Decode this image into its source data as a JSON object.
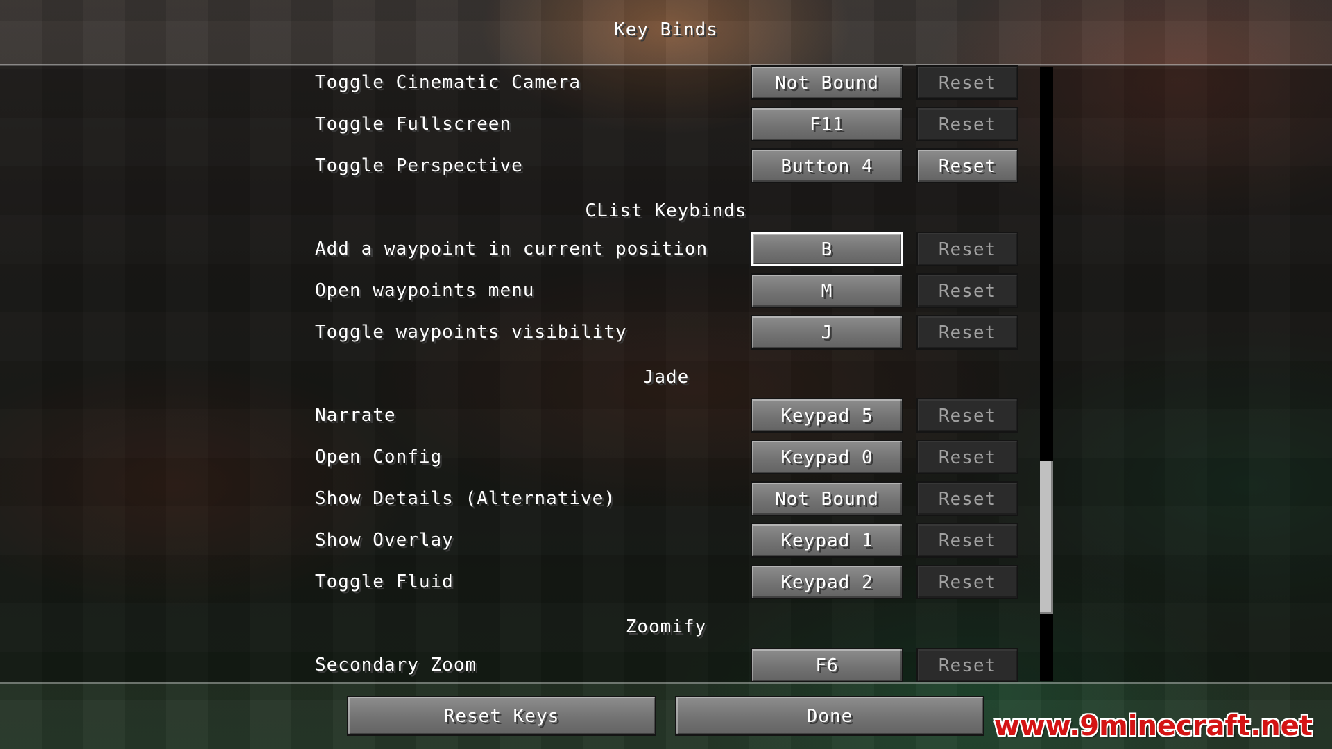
{
  "screen": {
    "title": "Key Binds"
  },
  "rows": {
    "toggle_cinematic_camera": {
      "label": "Toggle Cinematic Camera",
      "key": "Not Bound",
      "reset": "Reset"
    },
    "toggle_fullscreen": {
      "label": "Toggle Fullscreen",
      "key": "F11",
      "reset": "Reset"
    },
    "toggle_perspective": {
      "label": "Toggle Perspective",
      "key": "Button 4",
      "reset": "Reset"
    }
  },
  "categories": {
    "clist": {
      "title": "CList Keybinds",
      "add_waypoint": {
        "label": "Add a waypoint in current position",
        "key": "B",
        "reset": "Reset"
      },
      "open_waypoints_menu": {
        "label": "Open waypoints menu",
        "key": "M",
        "reset": "Reset"
      },
      "toggle_waypoints_visibility": {
        "label": "Toggle waypoints visibility",
        "key": "J",
        "reset": "Reset"
      }
    },
    "jade": {
      "title": "Jade",
      "narrate": {
        "label": "Narrate",
        "key": "Keypad 5",
        "reset": "Reset"
      },
      "open_config": {
        "label": "Open Config",
        "key": "Keypad 0",
        "reset": "Reset"
      },
      "show_details_alternative": {
        "label": "Show Details (Alternative)",
        "key": "Not Bound",
        "reset": "Reset"
      },
      "show_overlay": {
        "label": "Show Overlay",
        "key": "Keypad 1",
        "reset": "Reset"
      },
      "toggle_fluid": {
        "label": "Toggle Fluid",
        "key": "Keypad 2",
        "reset": "Reset"
      }
    },
    "zoomify": {
      "title": "Zoomify",
      "secondary_zoom": {
        "label": "Secondary Zoom",
        "key": "F6",
        "reset": "Reset"
      }
    }
  },
  "footer": {
    "reset_keys_label": "Reset Keys",
    "done_label": "Done"
  },
  "watermark": {
    "text": "www.9minecraft.net"
  },
  "colors": {
    "watermark": "#d41414",
    "button_face": "#7a7a7a",
    "button_disabled": "#2b2b2b",
    "focus_border": "#ffffff"
  }
}
